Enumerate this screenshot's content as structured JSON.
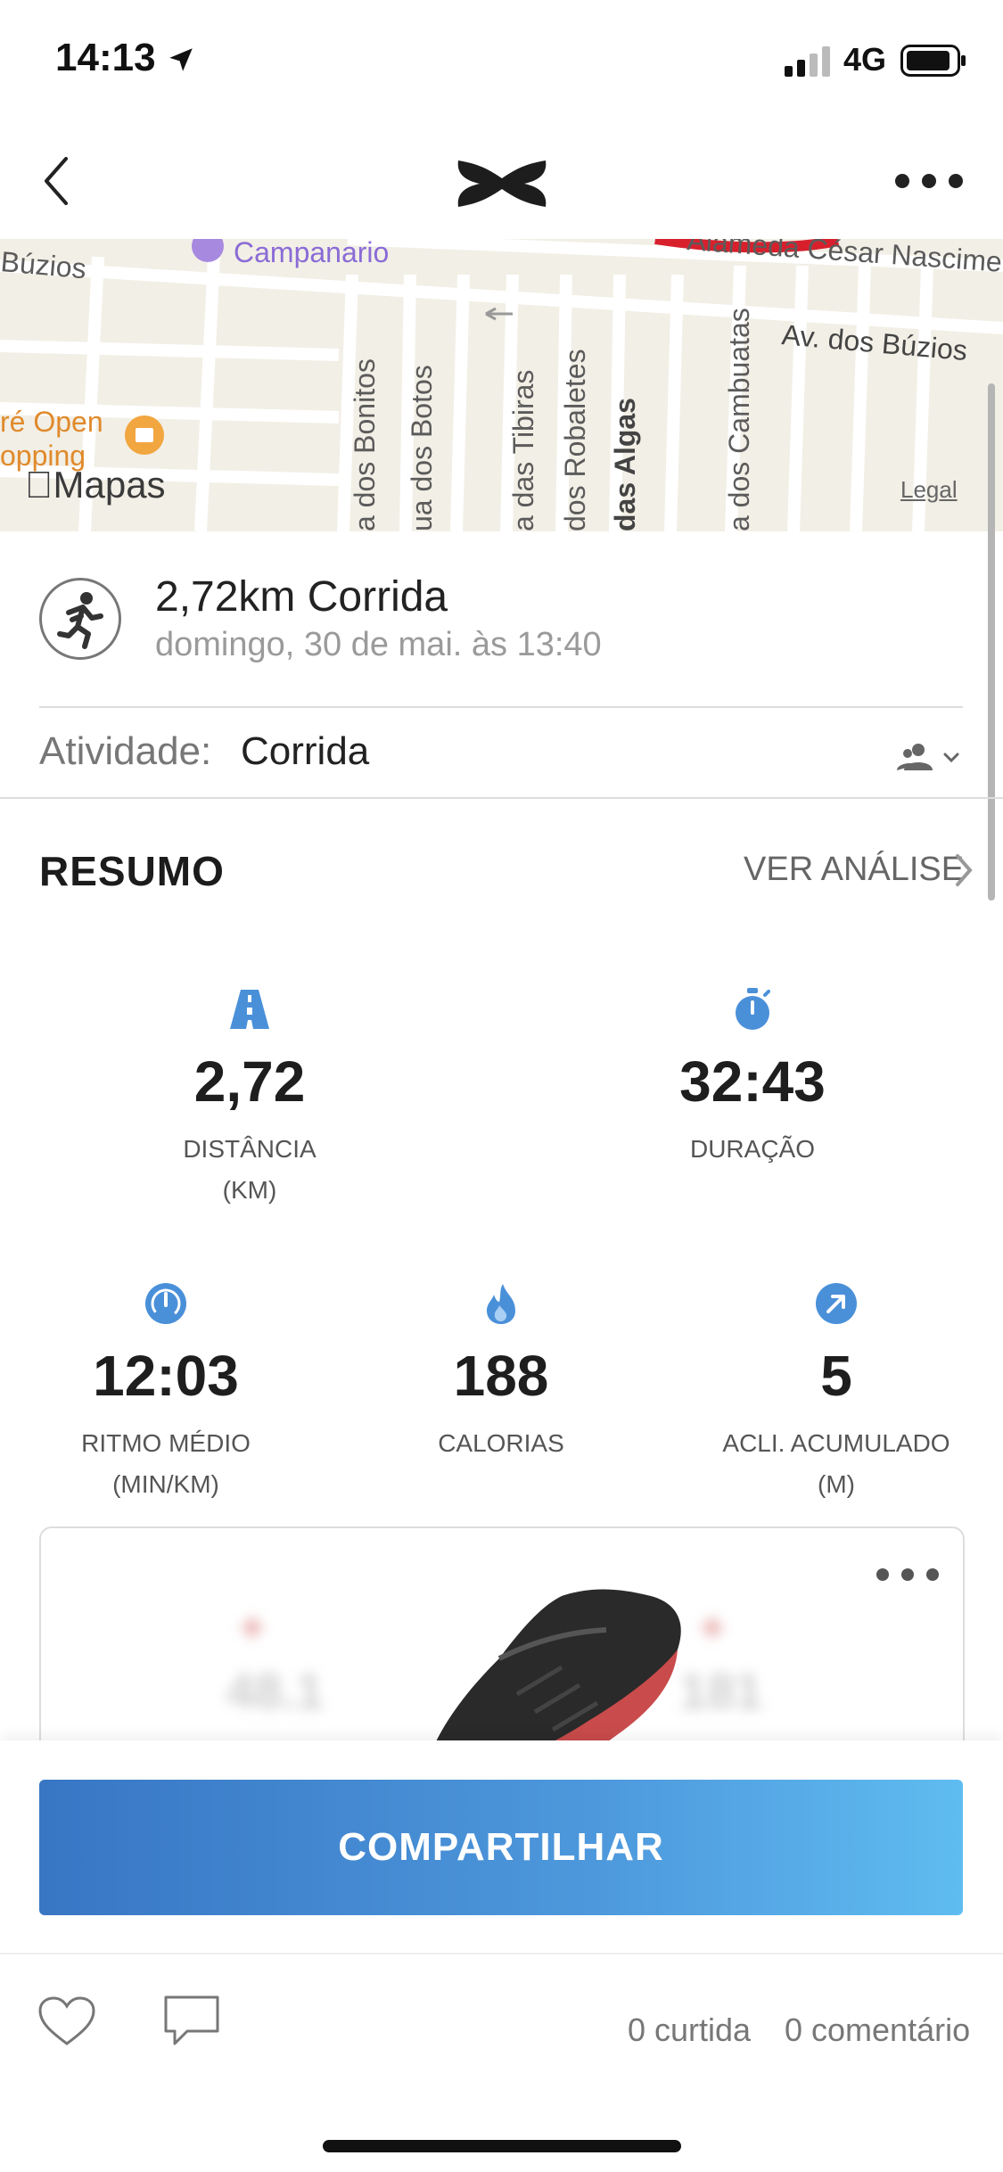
{
  "status_bar": {
    "time": "14:13",
    "network": "4G"
  },
  "map": {
    "labels": [
      "Búzios",
      "Campanario",
      "Alameda César Nascimento",
      "Av. dos Búzios",
      "a dos Bonitos",
      "ua dos Botos",
      "a das Tibiras",
      "dos Robaletes",
      "das Algas",
      "a dos Cambuatas",
      "ré Open",
      "opping"
    ],
    "brand": "Mapas",
    "legal": "Legal"
  },
  "workout": {
    "title": "2,72km Corrida",
    "date": "domingo, 30 de mai. às 13:40",
    "activity_label": "Atividade:",
    "activity_value": "Corrida"
  },
  "summary": {
    "title": "RESUMO",
    "analysis_link": "VER ANÁLISE",
    "stats": [
      {
        "value": "2,72",
        "label": "DISTÂNCIA",
        "unit": "(KM)",
        "icon": "road-icon"
      },
      {
        "value": "32:43",
        "label": "DURAÇÃO",
        "unit": "",
        "icon": "stopwatch-icon"
      },
      {
        "value": "12:03",
        "label": "RITMO MÉDIO",
        "unit": "(MIN/KM)",
        "icon": "speedometer-icon"
      },
      {
        "value": "188",
        "label": "CALORIAS",
        "unit": "",
        "icon": "flame-icon"
      },
      {
        "value": "5",
        "label": "ACLI. ACUMULADO",
        "unit": "(M)",
        "icon": "arrow-up-right-icon"
      }
    ]
  },
  "shoe_card": {
    "left_value": "48.1",
    "right_value": "181"
  },
  "actions": {
    "share_label": "COMPARTILHAR",
    "likes": "0 curtida",
    "comments": "0 comentário"
  },
  "colors": {
    "accent_blue": "#4a90d9",
    "share_start": "#3876c4",
    "share_end": "#5fbcf0"
  }
}
